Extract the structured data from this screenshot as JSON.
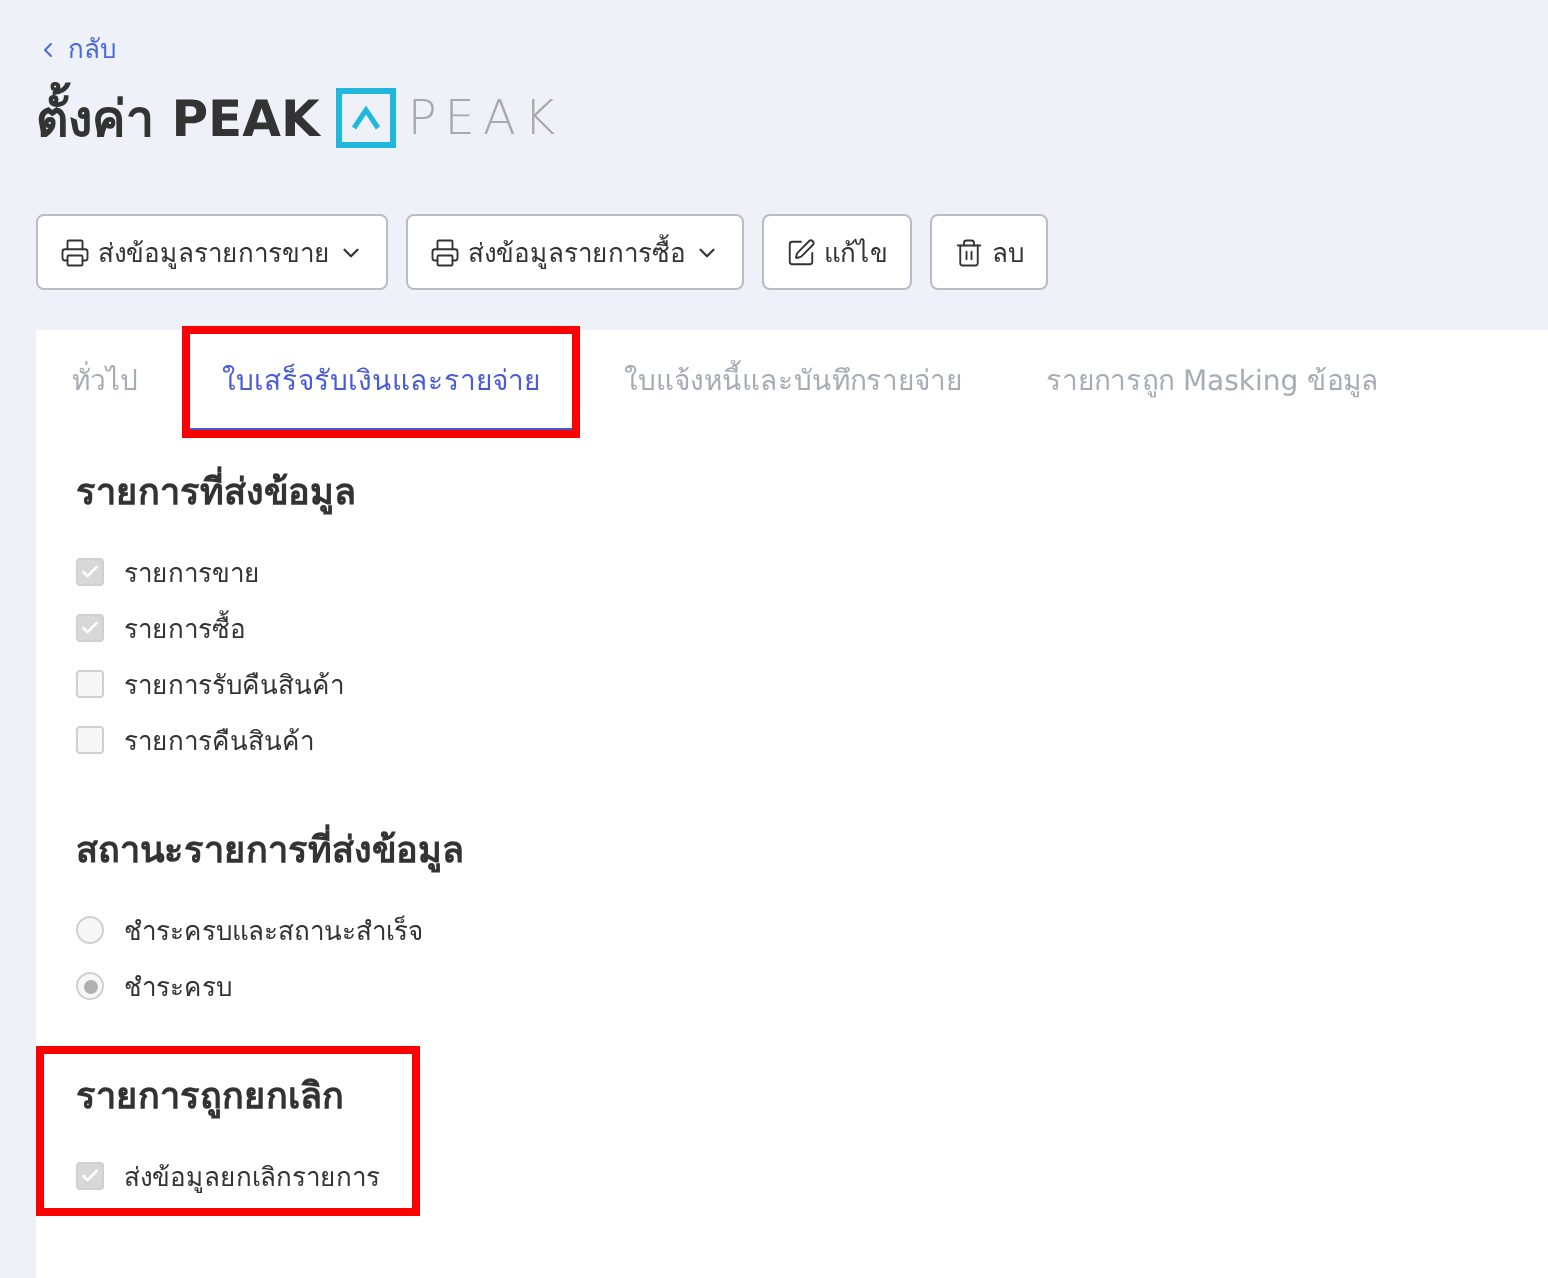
{
  "back_link": "กลับ",
  "title": "ตั้งค่า PEAK",
  "logo_wordmark": "PEAK",
  "toolbar": [
    {
      "label": "ส่งข้อมูลรายการขาย",
      "kind": "send-menu"
    },
    {
      "label": "ส่งข้อมูลรายการซื้อ",
      "kind": "send-menu"
    },
    {
      "label": "แก้ไข",
      "kind": "edit"
    },
    {
      "label": "ลบ",
      "kind": "delete"
    }
  ],
  "tabs": [
    {
      "label": "ทั่วไป",
      "selected": false,
      "highlighted": false
    },
    {
      "label": "ใบเสร็จรับเงินและรายจ่าย",
      "selected": true,
      "highlighted": true
    },
    {
      "label": "ใบแจ้งหนี้และบันทึกรายจ่าย",
      "selected": false,
      "highlighted": false
    },
    {
      "label": "รายการถูก Masking ข้อมูล",
      "selected": false,
      "highlighted": false
    }
  ],
  "sections": [
    {
      "title": "รายการที่ส่งข้อมูล",
      "highlighted": false,
      "options": [
        {
          "kind": "checkbox",
          "label": "รายการขาย",
          "checked": true
        },
        {
          "kind": "checkbox",
          "label": "รายการซื้อ",
          "checked": true
        },
        {
          "kind": "checkbox",
          "label": "รายการรับคืนสินค้า",
          "checked": false
        },
        {
          "kind": "checkbox",
          "label": "รายการคืนสินค้า",
          "checked": false
        }
      ]
    },
    {
      "title": "สถานะรายการที่ส่งข้อมูล",
      "highlighted": false,
      "options": [
        {
          "kind": "radio",
          "label": "ชำระครบและสถานะสำเร็จ",
          "selected": false
        },
        {
          "kind": "radio",
          "label": "ชำระครบ",
          "selected": true
        }
      ]
    },
    {
      "title": "รายการถูกยกเลิก",
      "highlighted": true,
      "options": [
        {
          "kind": "checkbox",
          "label": "ส่งข้อมูลยกเลิกรายการ",
          "checked": true
        }
      ]
    }
  ]
}
